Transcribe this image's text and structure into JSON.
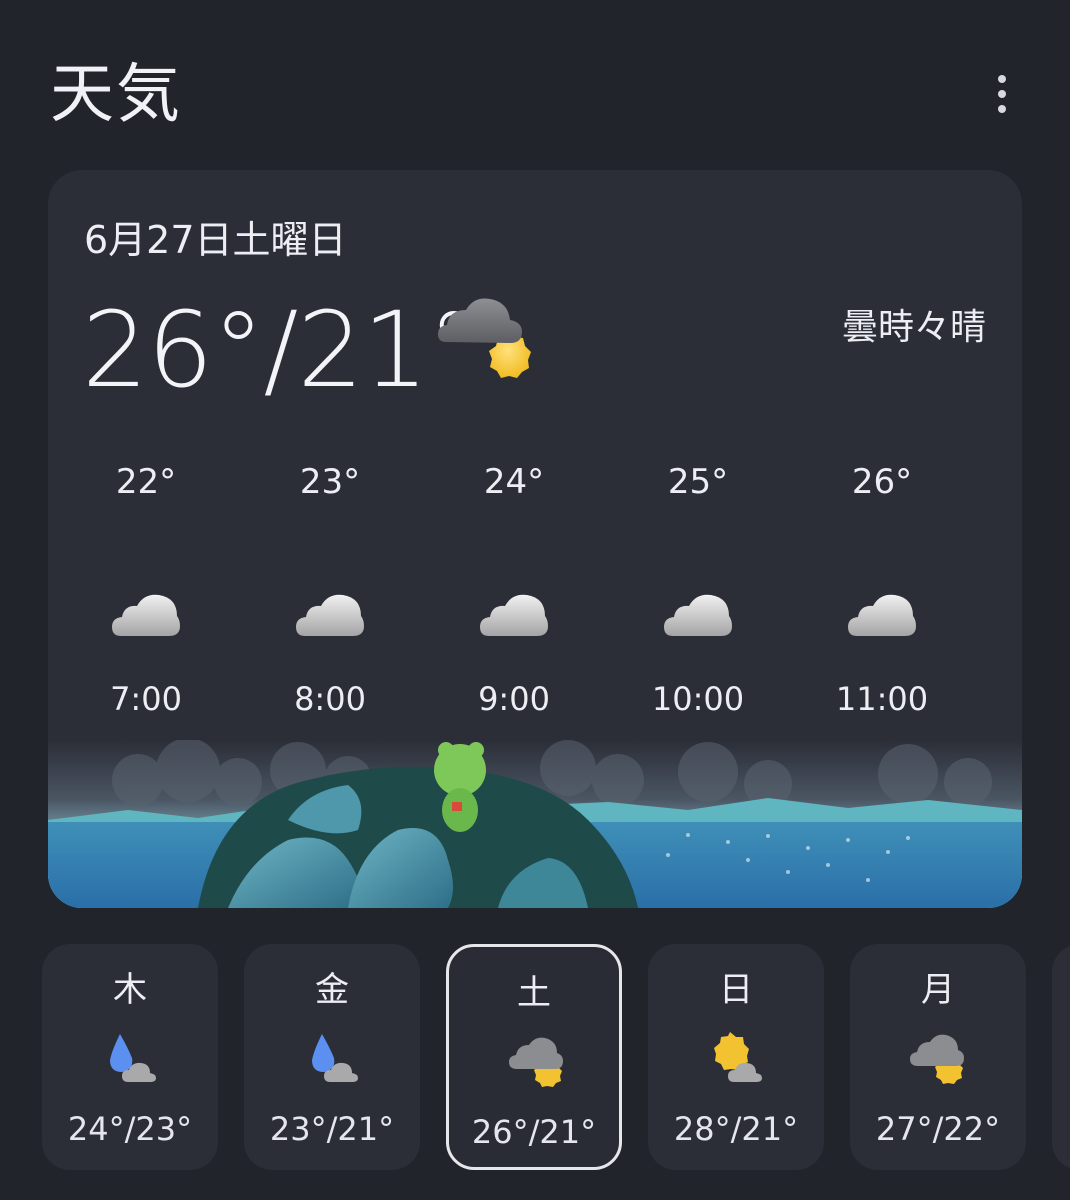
{
  "app": {
    "title": "天気"
  },
  "current": {
    "date": "6月27日土曜日",
    "temp_range": "26°/21°",
    "condition": "曇時々晴",
    "icon": "cloud-sun-icon"
  },
  "hourly": [
    {
      "temp": "22°",
      "time": "7:00",
      "icon": "cloud-icon"
    },
    {
      "temp": "23°",
      "time": "8:00",
      "icon": "cloud-icon"
    },
    {
      "temp": "24°",
      "time": "9:00",
      "icon": "cloud-icon"
    },
    {
      "temp": "25°",
      "time": "10:00",
      "icon": "cloud-icon"
    },
    {
      "temp": "26°",
      "time": "11:00",
      "icon": "cloud-icon"
    }
  ],
  "daily": [
    {
      "day": "木",
      "range": "24°/23°",
      "icon": "rain-cloud-icon"
    },
    {
      "day": "金",
      "range": "23°/21°",
      "icon": "rain-cloud-icon"
    },
    {
      "day": "土",
      "range": "26°/21°",
      "icon": "cloud-sun-icon",
      "selected": true
    },
    {
      "day": "日",
      "range": "28°/21°",
      "icon": "sun-cloud-icon"
    },
    {
      "day": "月",
      "range": "27°/22°",
      "icon": "cloud-sun-icon"
    }
  ],
  "colors": {
    "background": "#22242c",
    "card": "#2b2e37",
    "sun": "#f2c230",
    "rain": "#5b8ff0",
    "cloud": "#c9c9c9"
  }
}
